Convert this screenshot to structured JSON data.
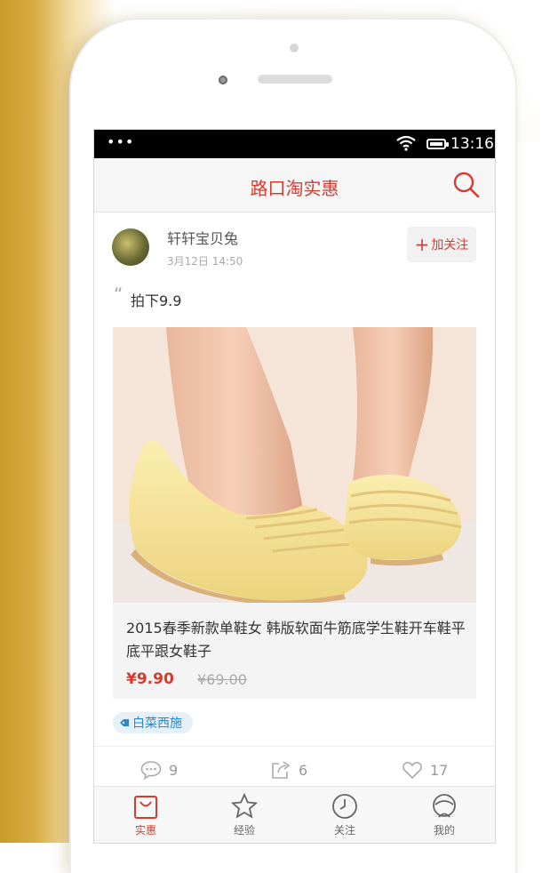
{
  "statusbar": {
    "signal": "•••",
    "time": "13:16"
  },
  "header": {
    "title": "路口淘实惠"
  },
  "post": {
    "user_name": "轩轩宝贝兔",
    "time": "3月12日 14:50",
    "follow_label": "加关注",
    "text": "拍下9.9",
    "product": {
      "title": "2015春季新款单鞋女 韩版软面牛筋底学生鞋开车鞋平底平跟女鞋子",
      "price": "¥9.90",
      "original_price": "¥69.00"
    },
    "tag": "白菜西施",
    "stats": {
      "comments": "9",
      "shares": "6",
      "likes": "17"
    }
  },
  "tabbar": {
    "items": [
      {
        "label": "实惠",
        "icon": "shopping-bag-icon",
        "active": true
      },
      {
        "label": "经验",
        "icon": "star-icon",
        "active": false
      },
      {
        "label": "关注",
        "icon": "clock-icon",
        "active": false
      },
      {
        "label": "我的",
        "icon": "user-icon",
        "active": false
      }
    ]
  },
  "colors": {
    "accent": "#d83a2f",
    "tag": "#2f86c8"
  }
}
